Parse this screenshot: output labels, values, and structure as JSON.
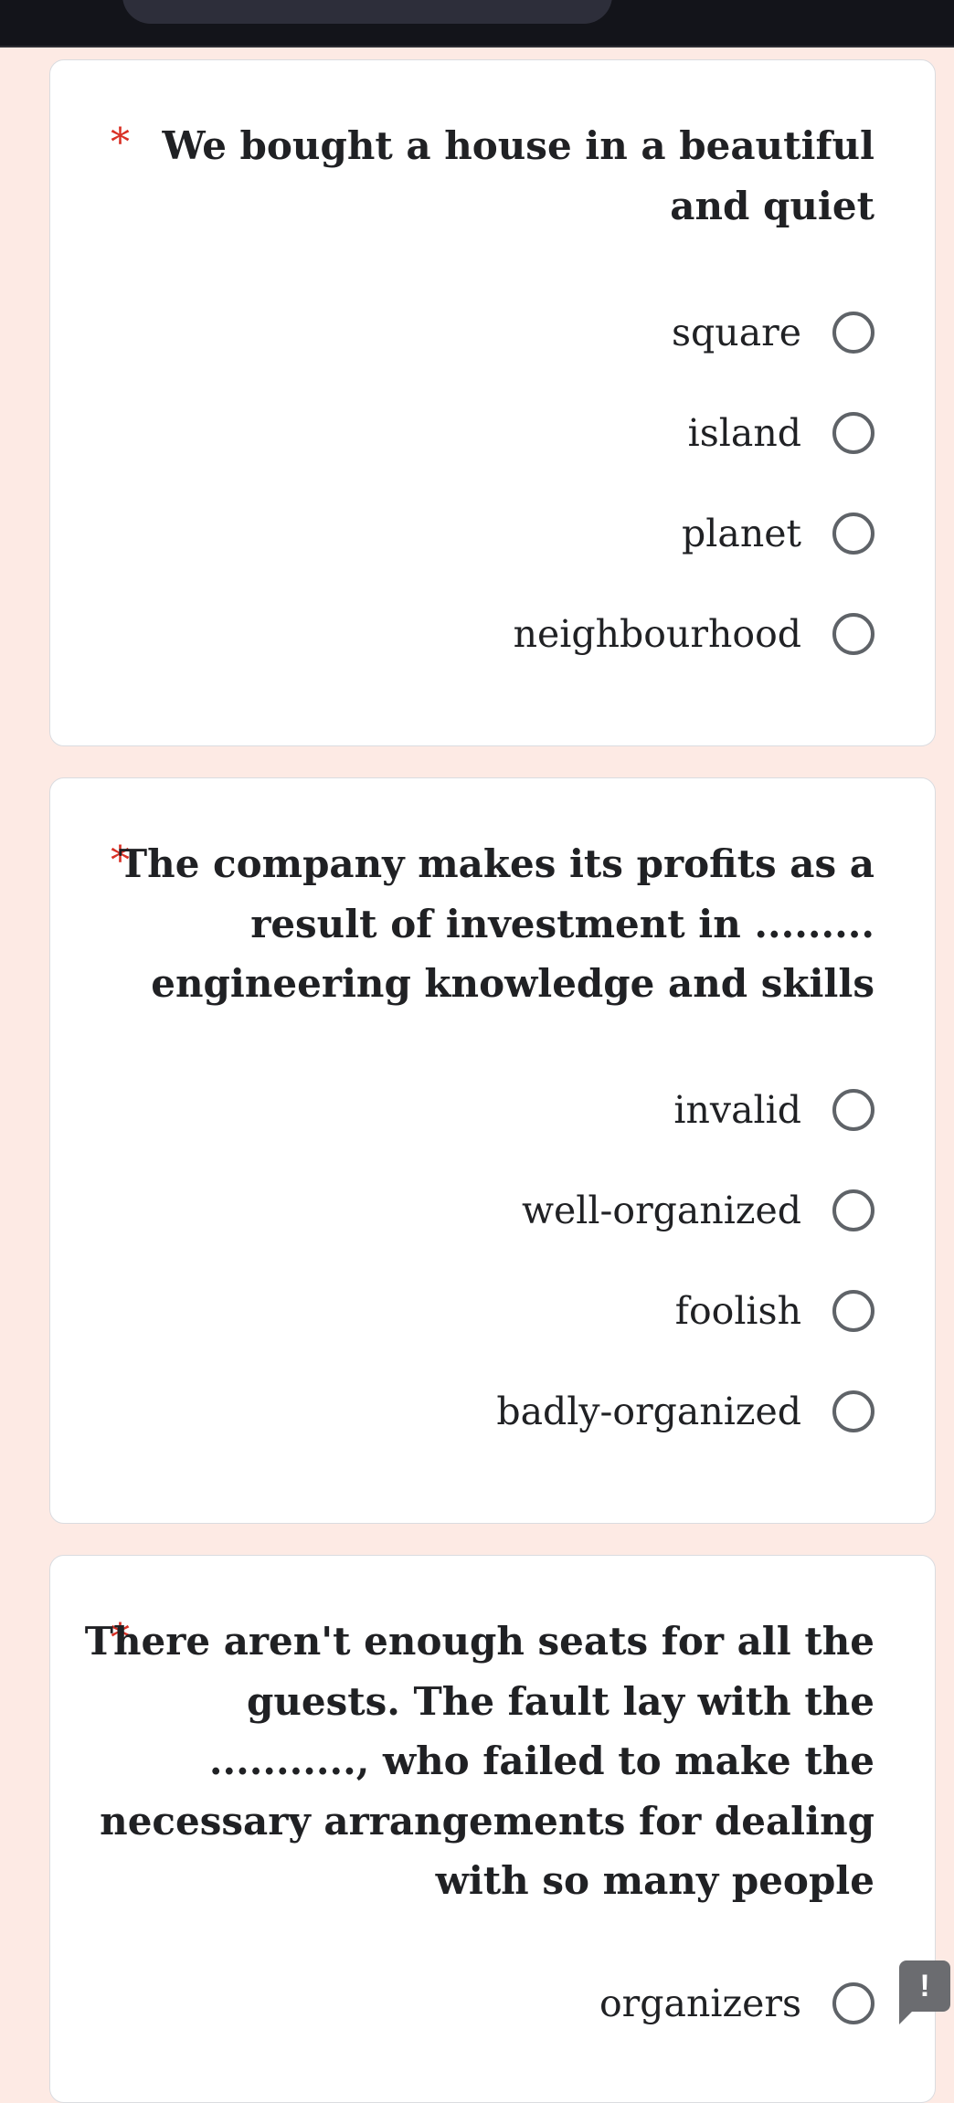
{
  "questions": [
    {
      "required_mark": "*",
      "lines": [
        "We bought a house in a beautiful",
        "and quiet"
      ],
      "options": [
        "square",
        "island",
        "planet",
        "neighbourhood"
      ]
    },
    {
      "required_mark": "*",
      "lines": [
        "The company makes its profits as a",
        "result of investment in .........",
        "engineering knowledge and skills"
      ],
      "options": [
        "invalid",
        "well-organized",
        "foolish",
        "badly-organized"
      ]
    },
    {
      "required_mark": "*",
      "lines": [
        "There aren't enough seats for all the",
        "guests. The fault lay with the",
        "..........., who failed to make the",
        "necessary arrangements for dealing",
        "with so many people"
      ],
      "options": [
        "organizers"
      ]
    }
  ],
  "report_button": {
    "icon": "exclamation-icon",
    "glyph": "!"
  }
}
